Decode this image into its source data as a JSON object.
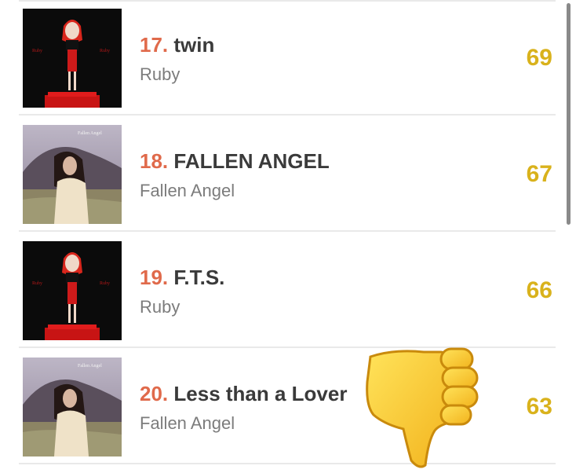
{
  "tracks": [
    {
      "rank": "17.",
      "title": "twin",
      "album": "Ruby",
      "score": "69",
      "cover": "ruby"
    },
    {
      "rank": "18.",
      "title": "FALLEN ANGEL",
      "album": "Fallen Angel",
      "score": "67",
      "cover": "fallen-angel"
    },
    {
      "rank": "19.",
      "title": "F.T.S.",
      "album": "Ruby",
      "score": "66",
      "cover": "ruby"
    },
    {
      "rank": "20.",
      "title": "Less than a Lover",
      "album": "Fallen Angel",
      "score": "63",
      "cover": "fallen-angel"
    }
  ],
  "overlay": {
    "emoji": "thumbs-down-icon"
  },
  "colors": {
    "rank": "#e06a4b",
    "score": "#d9b21c",
    "title": "#3a3a3a",
    "album": "#7c7c7c"
  }
}
